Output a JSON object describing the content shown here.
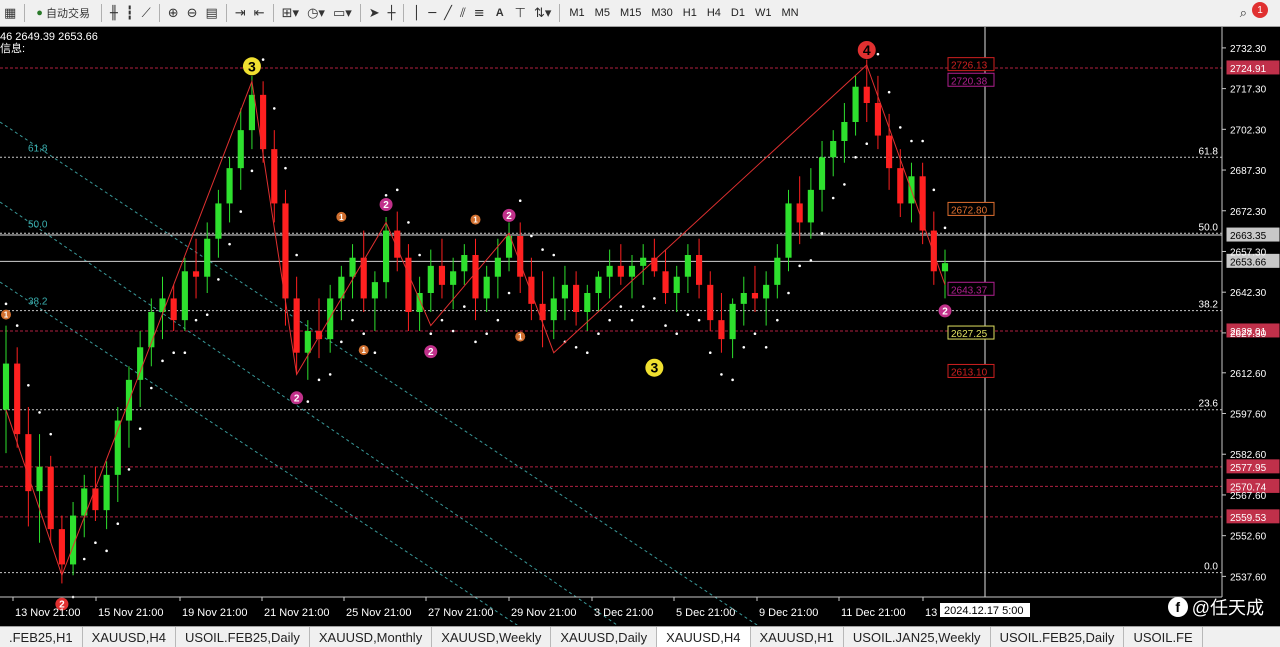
{
  "toolbar": {
    "auto_trade_label": "自动交易",
    "text_tool_label": "A",
    "periods": [
      "M1",
      "M5",
      "M15",
      "M30",
      "H1",
      "H4",
      "D1",
      "W1",
      "MN"
    ],
    "notification_count": "1"
  },
  "chart_info": {
    "price_line": "46 2649.39 2653.66",
    "info_label": "信息:"
  },
  "chart_data": {
    "type": "candlestick",
    "symbol": "XAUUSD",
    "timeframe": "H4",
    "ylim": [
      2530,
      2740
    ],
    "y_ticks": [
      "2732.30",
      "2717.30",
      "2702.30",
      "2687.30",
      "2672.30",
      "2657.30",
      "2642.30",
      "2627.30",
      "2612.60",
      "2597.60",
      "2582.60",
      "2567.60",
      "2552.60",
      "2537.60"
    ],
    "x_ticks": [
      "13 Nov 21:00",
      "15 Nov 21:00",
      "19 Nov 21:00",
      "21 Nov 21:00",
      "25 Nov 21:00",
      "27 Nov 21:00",
      "29 Nov 21:00",
      "3 Dec 21:00",
      "5 Dec 21:00",
      "9 Dec 21:00",
      "11 Dec 21:00",
      "13"
    ],
    "crosshair_time": "2024.12.17 5:00",
    "current_price": "2653.66",
    "fib_levels": [
      {
        "label": "61.8",
        "price": 2692.0,
        "tag": "61.8"
      },
      {
        "label": "50.0",
        "price": 2664.0,
        "tag": "50.0"
      },
      {
        "label": "38.2",
        "price": 2635.5,
        "tag": "38.2"
      },
      {
        "label": "",
        "price": 2599.0,
        "tag": "23.6"
      },
      {
        "label": "",
        "price": 2539.0,
        "tag": "0.0"
      }
    ],
    "price_tags": [
      {
        "value": "2724.91",
        "price": 2724.91,
        "side": "right",
        "color": "#c0304a"
      },
      {
        "value": "2663.35",
        "price": 2663.35,
        "side": "right",
        "color": "#c8c8c8"
      },
      {
        "value": "2653.66",
        "price": 2653.66,
        "side": "right",
        "color": "#c8c8c8"
      },
      {
        "value": "2628.01",
        "price": 2628.01,
        "side": "right",
        "color": "#c0304a"
      },
      {
        "value": "2577.95",
        "price": 2577.95,
        "side": "right",
        "color": "#c0304a"
      },
      {
        "value": "2570.74",
        "price": 2570.74,
        "side": "right",
        "color": "#c0304a"
      },
      {
        "value": "2559.53",
        "price": 2559.53,
        "side": "right",
        "color": "#c0304a"
      },
      {
        "value": "2726.13",
        "price": 2726.13,
        "side": "mid",
        "color": "#d02020"
      },
      {
        "value": "2720.38",
        "price": 2720.38,
        "side": "mid",
        "color": "#b02090"
      },
      {
        "value": "2672.80",
        "price": 2672.8,
        "side": "mid",
        "color": "#e07030"
      },
      {
        "value": "2643.37",
        "price": 2643.37,
        "side": "mid",
        "color": "#b02090"
      },
      {
        "value": "2627.25",
        "price": 2627.25,
        "side": "mid",
        "color": "#e0e060"
      },
      {
        "value": "2613.10",
        "price": 2613.1,
        "side": "mid",
        "color": "#d02020"
      }
    ],
    "red_levels": [
      2724.91,
      2628.01,
      2577.95,
      2570.74,
      2559.53
    ],
    "candles": [
      [
        2599,
        2630,
        2583,
        2616
      ],
      [
        2616,
        2622,
        2585,
        2590
      ],
      [
        2590,
        2600,
        2556,
        2569
      ],
      [
        2569,
        2590,
        2550,
        2578
      ],
      [
        2578,
        2582,
        2550,
        2555
      ],
      [
        2555,
        2560,
        2535,
        2542
      ],
      [
        2542,
        2565,
        2538,
        2560
      ],
      [
        2560,
        2575,
        2552,
        2570
      ],
      [
        2570,
        2578,
        2558,
        2562
      ],
      [
        2562,
        2580,
        2555,
        2575
      ],
      [
        2575,
        2600,
        2565,
        2595
      ],
      [
        2595,
        2615,
        2585,
        2610
      ],
      [
        2610,
        2628,
        2600,
        2622
      ],
      [
        2622,
        2640,
        2615,
        2635
      ],
      [
        2635,
        2648,
        2625,
        2640
      ],
      [
        2640,
        2645,
        2628,
        2632
      ],
      [
        2632,
        2655,
        2628,
        2650
      ],
      [
        2650,
        2662,
        2640,
        2648
      ],
      [
        2648,
        2668,
        2642,
        2662
      ],
      [
        2662,
        2680,
        2655,
        2675
      ],
      [
        2675,
        2692,
        2668,
        2688
      ],
      [
        2688,
        2710,
        2680,
        2702
      ],
      [
        2702,
        2722,
        2695,
        2715
      ],
      [
        2715,
        2720,
        2690,
        2695
      ],
      [
        2695,
        2702,
        2668,
        2675
      ],
      [
        2675,
        2680,
        2630,
        2640
      ],
      [
        2640,
        2648,
        2612,
        2620
      ],
      [
        2620,
        2632,
        2610,
        2628
      ],
      [
        2628,
        2640,
        2618,
        2625
      ],
      [
        2625,
        2645,
        2620,
        2640
      ],
      [
        2640,
        2652,
        2632,
        2648
      ],
      [
        2648,
        2660,
        2640,
        2655
      ],
      [
        2655,
        2665,
        2635,
        2640
      ],
      [
        2640,
        2650,
        2628,
        2646
      ],
      [
        2646,
        2670,
        2640,
        2665
      ],
      [
        2665,
        2672,
        2650,
        2655
      ],
      [
        2655,
        2660,
        2628,
        2635
      ],
      [
        2635,
        2648,
        2628,
        2642
      ],
      [
        2642,
        2658,
        2635,
        2652
      ],
      [
        2652,
        2662,
        2640,
        2645
      ],
      [
        2645,
        2655,
        2636,
        2650
      ],
      [
        2650,
        2660,
        2645,
        2656
      ],
      [
        2656,
        2662,
        2632,
        2640
      ],
      [
        2640,
        2652,
        2635,
        2648
      ],
      [
        2648,
        2662,
        2640,
        2655
      ],
      [
        2655,
        2668,
        2650,
        2663
      ],
      [
        2663,
        2668,
        2642,
        2648
      ],
      [
        2648,
        2655,
        2632,
        2638
      ],
      [
        2638,
        2650,
        2622,
        2632
      ],
      [
        2632,
        2648,
        2625,
        2640
      ],
      [
        2640,
        2652,
        2632,
        2645
      ],
      [
        2645,
        2650,
        2630,
        2635
      ],
      [
        2635,
        2645,
        2628,
        2642
      ],
      [
        2642,
        2650,
        2635,
        2648
      ],
      [
        2648,
        2658,
        2640,
        2652
      ],
      [
        2652,
        2660,
        2645,
        2648
      ],
      [
        2648,
        2656,
        2640,
        2652
      ],
      [
        2652,
        2660,
        2645,
        2655
      ],
      [
        2655,
        2662,
        2648,
        2650
      ],
      [
        2650,
        2658,
        2638,
        2642
      ],
      [
        2642,
        2652,
        2635,
        2648
      ],
      [
        2648,
        2660,
        2642,
        2656
      ],
      [
        2656,
        2662,
        2640,
        2645
      ],
      [
        2645,
        2650,
        2628,
        2632
      ],
      [
        2632,
        2642,
        2620,
        2625
      ],
      [
        2625,
        2640,
        2618,
        2638
      ],
      [
        2638,
        2648,
        2630,
        2642
      ],
      [
        2642,
        2652,
        2635,
        2640
      ],
      [
        2640,
        2650,
        2630,
        2645
      ],
      [
        2645,
        2660,
        2640,
        2655
      ],
      [
        2655,
        2680,
        2650,
        2675
      ],
      [
        2675,
        2685,
        2660,
        2668
      ],
      [
        2668,
        2688,
        2662,
        2680
      ],
      [
        2680,
        2698,
        2672,
        2692
      ],
      [
        2692,
        2702,
        2685,
        2698
      ],
      [
        2698,
        2712,
        2690,
        2705
      ],
      [
        2705,
        2722,
        2700,
        2718
      ],
      [
        2718,
        2728,
        2705,
        2712
      ],
      [
        2712,
        2722,
        2695,
        2700
      ],
      [
        2700,
        2708,
        2680,
        2688
      ],
      [
        2688,
        2695,
        2670,
        2675
      ],
      [
        2675,
        2690,
        2668,
        2685
      ],
      [
        2685,
        2690,
        2660,
        2665
      ],
      [
        2665,
        2672,
        2645,
        2650
      ],
      [
        2650,
        2658,
        2640,
        2653
      ]
    ],
    "zigzag": [
      [
        0,
        2599
      ],
      [
        5,
        2538
      ],
      [
        22,
        2720
      ],
      [
        26,
        2612
      ],
      [
        34,
        2668
      ],
      [
        38,
        2630
      ],
      [
        45,
        2664
      ],
      [
        49,
        2620
      ],
      [
        77,
        2726
      ],
      [
        84,
        2645
      ]
    ],
    "waves": [
      {
        "label": "3",
        "idx": 22,
        "price": 2720,
        "pos": "above",
        "color": "#f0e030",
        "big": true
      },
      {
        "label": "4",
        "idx": 77,
        "price": 2726,
        "pos": "above",
        "color": "#e03030",
        "big": true
      },
      {
        "label": "3",
        "idx": 58,
        "price": 2620,
        "pos": "below",
        "color": "#f0e030",
        "big": true
      },
      {
        "label": "2",
        "idx": 26,
        "price": 2608,
        "pos": "below",
        "color": "#c0308a",
        "big": false
      },
      {
        "label": "2",
        "idx": 34,
        "price": 2670,
        "pos": "above",
        "color": "#c0308a",
        "big": false
      },
      {
        "label": "2",
        "idx": 38,
        "price": 2625,
        "pos": "below",
        "color": "#c0308a",
        "big": false
      },
      {
        "label": "2",
        "idx": 45,
        "price": 2666,
        "pos": "above",
        "color": "#c0308a",
        "big": false
      },
      {
        "label": "2",
        "idx": 84,
        "price": 2640,
        "pos": "below",
        "color": "#c0308a",
        "big": false
      },
      {
        "label": "2",
        "idx": 5,
        "price": 2532,
        "pos": "below",
        "color": "#e03030",
        "big": false
      },
      {
        "label": "1",
        "idx": 0,
        "price": 2630,
        "pos": "above",
        "color": "#d07030",
        "small": true
      },
      {
        "label": "1",
        "idx": 30,
        "price": 2666,
        "pos": "above",
        "color": "#d07030",
        "small": true
      },
      {
        "label": "1",
        "idx": 32,
        "price": 2625,
        "pos": "below",
        "color": "#d07030",
        "small": true
      },
      {
        "label": "1",
        "idx": 42,
        "price": 2665,
        "pos": "above",
        "color": "#d07030",
        "small": true
      },
      {
        "label": "1",
        "idx": 46,
        "price": 2630,
        "pos": "below",
        "color": "#d07030",
        "small": true
      }
    ]
  },
  "tabs": [
    {
      "label": ".FEB25,H1",
      "active": false
    },
    {
      "label": "XAUUSD,H4",
      "active": false
    },
    {
      "label": "USOIL.FEB25,Daily",
      "active": false
    },
    {
      "label": "XAUUSD,Monthly",
      "active": false
    },
    {
      "label": "XAUUSD,Weekly",
      "active": false
    },
    {
      "label": "XAUUSD,Daily",
      "active": false
    },
    {
      "label": "XAUUSD,H4",
      "active": true
    },
    {
      "label": "XAUUSD,H1",
      "active": false
    },
    {
      "label": "USOIL.JAN25,Weekly",
      "active": false
    },
    {
      "label": "USOIL.FEB25,Daily",
      "active": false
    },
    {
      "label": "USOIL.FE",
      "active": false
    }
  ],
  "watermark": {
    "logo": "f",
    "text": "@任天成"
  }
}
